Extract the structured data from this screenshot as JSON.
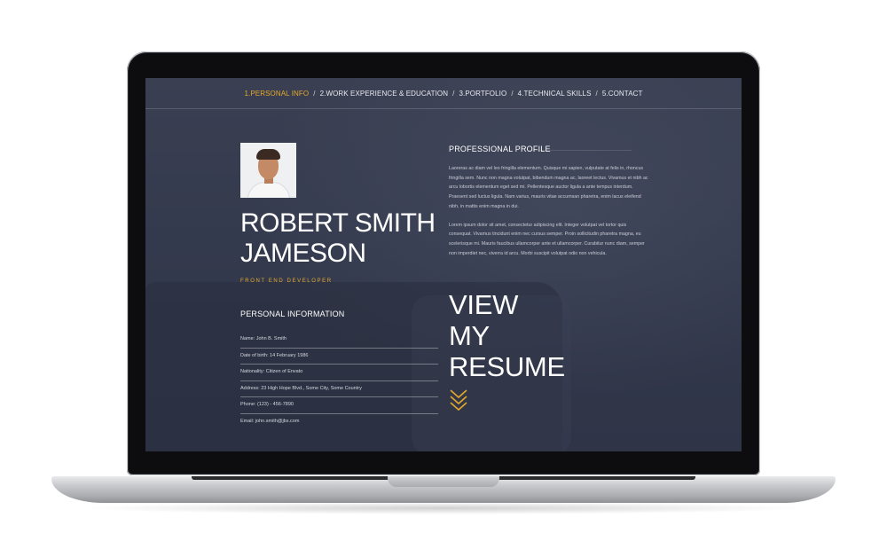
{
  "nav": [
    {
      "label": "1.PERSONAL INFO",
      "active": true
    },
    {
      "label": "2.WORK EXPERIENCE & EDUCATION",
      "active": false
    },
    {
      "label": "3.PORTFOLIO",
      "active": false
    },
    {
      "label": "4.TECHNICAL SKILLS",
      "active": false
    },
    {
      "label": "5.CONTACT",
      "active": false
    }
  ],
  "nav_separator": "/",
  "profile": {
    "name_line1": "ROBERT SMITH",
    "name_line2": "JAMESON",
    "role": "FRONT END DEVELOPER"
  },
  "personal_info": {
    "title": "PERSONAL INFORMATION",
    "items": [
      "Name: John B. Smith",
      "Date of birth: 14 February 1986",
      "Nationality: Citizen of Envato",
      "Address: 23 High Hope Blvd., Some City, Some Country",
      "Phone: (123) - 456-7890",
      "Email: john.smith@jbs.com"
    ]
  },
  "professional_profile": {
    "title": "PROFESSIONAL PROFILE",
    "paragraph1": "Laoreras ac diam vel leo fringilla elementum. Quisque mi sapien, vulputate at felis in, rhoncus fringilla sem. Nunc non magna volutpat, bibendum magna ac, laoreet lectus. Vivamus et nibh ac arcu lobortis elementum eget sed mi. Pellentesque auctor ligula a ante tempus interdum. Praesent sed luctus ligula. Nam varius, mauris vitae accumsan pharetra, enim lacus eleifend nibh, in mattis enim magna in dui.",
    "paragraph2": "Lorem ipsum dolor sit amet, consectetur adipiscing elit. Integer volutpat vel tortor quis consequat. Vivamus tincidunt enim nec cursus semper. Proin sollicitudin pharetra magna, eu scelerisque mi. Mauris faucibus ullamcorper ante et ullamcorper. Curabitur nunc diam, semper non imperdiet nec, viverra id arcu. Morbi suscipit volutpat odio non vehicula."
  },
  "cta": {
    "line1": "VIEW",
    "line2": "MY",
    "line3": "RESUME",
    "icon": "chevron-down-icon"
  },
  "colors": {
    "accent": "#e2a82a",
    "screen_bg": "#343a4d",
    "text": "#ffffff"
  }
}
